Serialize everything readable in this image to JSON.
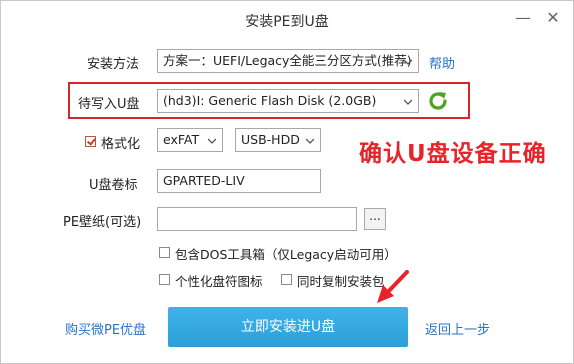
{
  "window": {
    "title": "安装PE到U盘"
  },
  "install_method": {
    "label": "安装方法",
    "value": "方案一：UEFI/Legacy全能三分区方式(推荐)",
    "help": "帮助"
  },
  "target_disk": {
    "label": "待写入U盘",
    "value": "(hd3)I: Generic Flash Disk (2.0GB)"
  },
  "format": {
    "label": "格式化",
    "checked": true,
    "fs_value": "exFAT",
    "mode_value": "USB-HDD"
  },
  "annotation": "确认U盘设备正确",
  "volume_label": {
    "label": "U盘卷标",
    "value": "GPARTED-LIV"
  },
  "wallpaper": {
    "label": "PE壁纸(可选)",
    "value": "",
    "browse": "..."
  },
  "options": {
    "dos_tools": "包含DOS工具箱（仅Legacy启动可用）",
    "custom_icon": "个性化盘符图标",
    "copy_package": "同时复制安装包"
  },
  "footer": {
    "buy_link": "购买微PE优盘",
    "install_button": "立即安装进U盘",
    "back_link": "返回上一步"
  },
  "colors": {
    "accent": "#2c9fd9",
    "annotation": "#e8232a",
    "link": "#2a73c8"
  }
}
